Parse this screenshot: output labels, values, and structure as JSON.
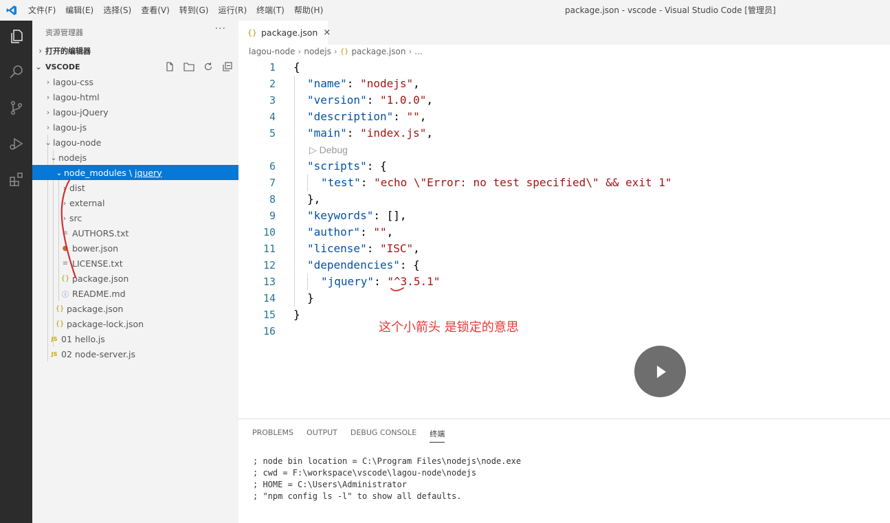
{
  "titlebar": {
    "menu": [
      "文件(F)",
      "编辑(E)",
      "选择(S)",
      "查看(V)",
      "转到(G)",
      "运行(R)",
      "终端(T)",
      "帮助(H)"
    ],
    "window_title": "package.json - vscode - Visual Studio Code [管理员]"
  },
  "activity_bar": {
    "icons": [
      "explorer-icon",
      "search-icon",
      "source-control-icon",
      "run-debug-icon",
      "extensions-icon"
    ]
  },
  "sidebar": {
    "title": "资源管理器",
    "more": "···",
    "open_editors": "打开的编辑器",
    "workspace": "VSCODE",
    "tree": [
      {
        "label": "lagou-css",
        "twisty": "›"
      },
      {
        "label": "lagou-html",
        "twisty": "›"
      },
      {
        "label": "lagou-jQuery",
        "twisty": "›"
      },
      {
        "label": "lagou-js",
        "twisty": "›"
      },
      {
        "label": "lagou-node",
        "twisty": "⌄"
      },
      {
        "label": "nodejs",
        "twisty": "⌄"
      },
      {
        "label": "node_modules",
        "sep": "\\",
        "link": "jquery",
        "twisty": "⌄"
      },
      {
        "label": "dist",
        "twisty": "›"
      },
      {
        "label": "external",
        "twisty": "›"
      },
      {
        "label": "src",
        "twisty": "›"
      },
      {
        "label": "AUTHORS.txt"
      },
      {
        "label": "bower.json"
      },
      {
        "label": "LICENSE.txt"
      },
      {
        "label": "package.json"
      },
      {
        "label": "README.md"
      },
      {
        "label": "package.json"
      },
      {
        "label": "package-lock.json"
      },
      {
        "label": "01 hello.js"
      },
      {
        "label": "02 node-server.js"
      }
    ]
  },
  "editor": {
    "tab_label": "package.json",
    "tab_close": "×",
    "breadcrumb": [
      "lagou-node",
      "nodejs",
      "package.json",
      "..."
    ],
    "codelens": "▷ Debug",
    "lines": [
      "1",
      "2",
      "3",
      "4",
      "5",
      "6",
      "7",
      "8",
      "9",
      "10",
      "11",
      "12",
      "13",
      "14",
      "15",
      "16"
    ],
    "code": {
      "l1": "{",
      "l2k": "\"name\"",
      "l2v": "\"nodejs\"",
      "l3k": "\"version\"",
      "l3v": "\"1.0.0\"",
      "l4k": "\"description\"",
      "l4v": "\"\"",
      "l5k": "\"main\"",
      "l5v": "\"index.js\"",
      "l6k": "\"scripts\"",
      "l7k": "\"test\"",
      "l7v": "\"echo \\\"Error: no test specified\\\" && exit 1\"",
      "l8": "},",
      "l9k": "\"keywords\"",
      "l9v": "[],",
      "l10k": "\"author\"",
      "l10v": "\"\"",
      "l11k": "\"license\"",
      "l11v": "\"ISC\"",
      "l12k": "\"dependencies\"",
      "l13k": "\"jquery\"",
      "l13v": "\"^3.5.1\"",
      "l14": "}",
      "l15": "}"
    },
    "annotation": "这个小箭头 是锁定的意思"
  },
  "panel": {
    "tabs": [
      "PROBLEMS",
      "OUTPUT",
      "DEBUG CONSOLE",
      "终端"
    ],
    "terminal": [
      "; node bin location = C:\\Program Files\\nodejs\\node.exe",
      "; cwd = F:\\workspace\\vscode\\lagou-node\\nodejs",
      "; HOME = C:\\Users\\Administrator",
      "; \"npm config ls -l\" to show all defaults."
    ]
  },
  "colors": {
    "selection": "#0678d7",
    "json_key": "#0451a5",
    "json_string": "#a31515",
    "annotation": "#e53935"
  }
}
